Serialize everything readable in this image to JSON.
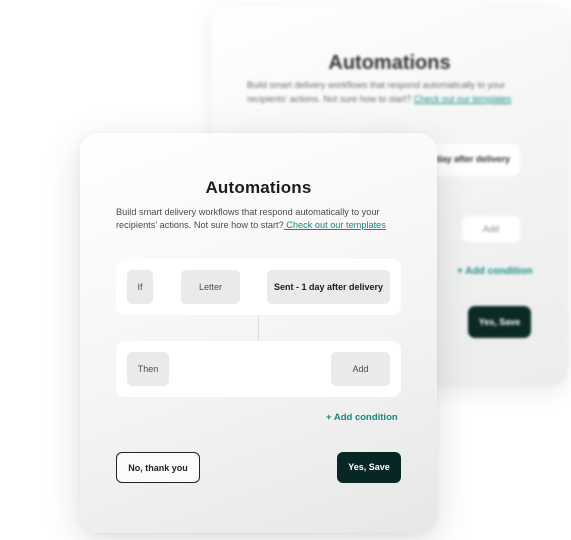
{
  "background_card": {
    "title": "Automations",
    "description": "Build smart delivery workflows that respond automatically to your recipients' actions. Not sure how to start?",
    "templates_link": "Check out our templates",
    "condition_partial": "day after delivery",
    "add_label": "Add",
    "add_condition_label": "+ Add condition",
    "save_label": "Yes, Save"
  },
  "modal": {
    "title": "Automations",
    "description": "Build smart delivery workflows that respond automatically to your recipients' actions. Not sure how to start?",
    "templates_link": " Check out our templates",
    "if_row": {
      "keyword": "If",
      "type_value": "Letter",
      "condition_value": "Sent - 1 day after delivery"
    },
    "then_row": {
      "keyword": "Then",
      "action_label": "Add"
    },
    "add_condition_label": "+ Add condition",
    "cancel_label": "No, thank you",
    "save_label": "Yes, Save"
  },
  "colors": {
    "accent_teal": "#17897d",
    "primary_dark": "#062723",
    "pill_gray": "#e9eaea"
  }
}
